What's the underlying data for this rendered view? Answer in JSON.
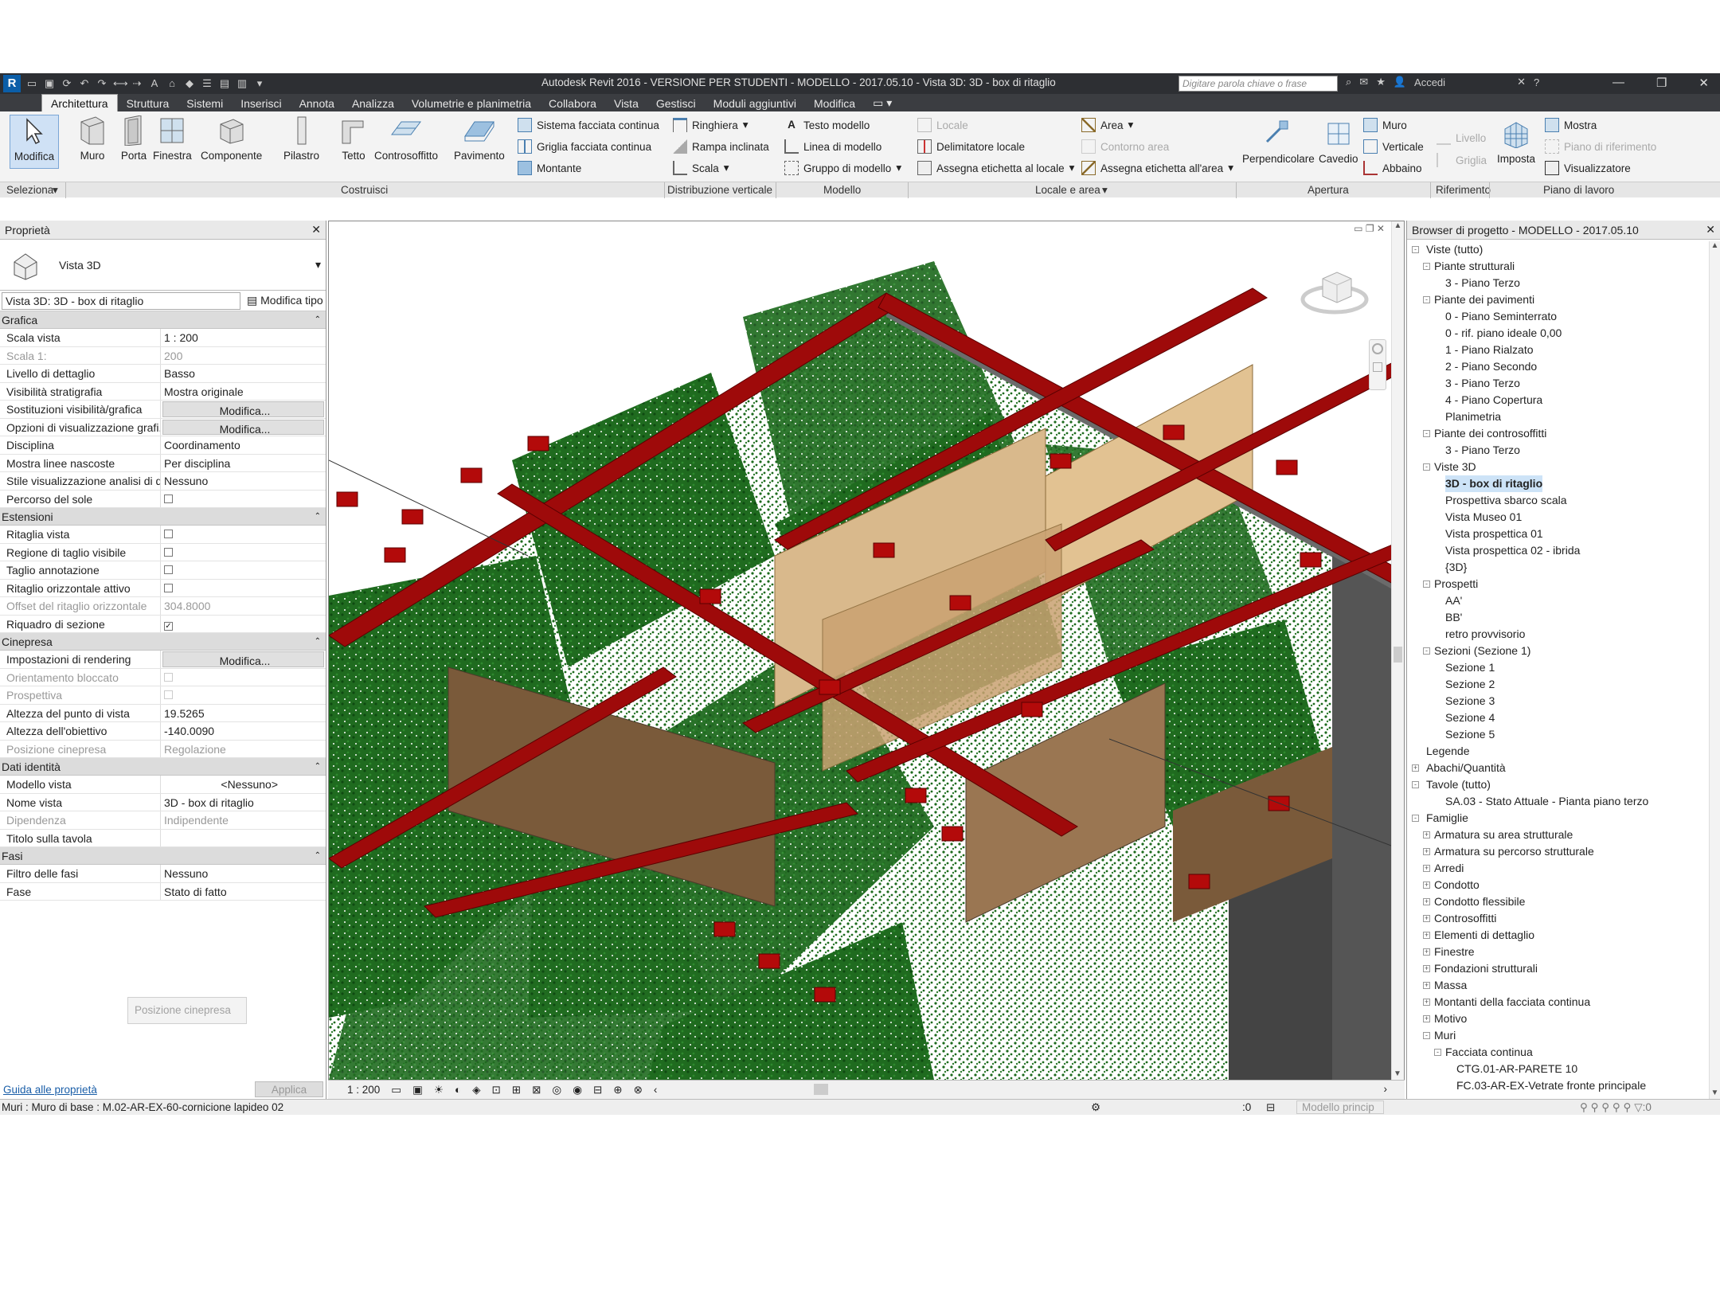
{
  "window": {
    "title": "Autodesk Revit 2016 - VERSIONE PER STUDENTI -    MODELLO - 2017.05.10 - Vista 3D: 3D - box di ritaglio",
    "search_placeholder": "Digitare parola chiave o frase",
    "signin": "Accedi"
  },
  "tabs": [
    "Architettura",
    "Struttura",
    "Sistemi",
    "Inserisci",
    "Annota",
    "Analizza",
    "Volumetrie e planimetria",
    "Collabora",
    "Vista",
    "Gestisci",
    "Moduli aggiuntivi",
    "Modifica"
  ],
  "ribbon": {
    "big": [
      "Modifica",
      "Muro",
      "Porta",
      "Finestra",
      "Componente",
      "Pilastro",
      "Tetto",
      "Controsoffitto",
      "Pavimento",
      "Perpendicolare",
      "Cavedio",
      "Livello",
      "Griglia",
      "Imposta"
    ],
    "small": [
      "Sistema facciata continua",
      "Griglia facciata continua",
      "Montante",
      "Ringhiera",
      "Rampa inclinata",
      "Scala",
      "Testo modello",
      "Linea di modello",
      "Gruppo di modello",
      "Locale",
      "Delimitatore  locale",
      "Assegna etichetta  al locale",
      "Area",
      "Contorno  area",
      "Assegna etichetta  all'area",
      "Muro",
      "Verticale",
      "Abbaino",
      "Mostra",
      "Piano di riferimento",
      "Visualizzatore"
    ],
    "panels": [
      "Seleziona",
      "Costruisci",
      "Distribuzione verticale",
      "Modello",
      "Locale e area",
      "Apertura",
      "Riferimento",
      "Piano di lavoro"
    ]
  },
  "properties": {
    "title": "Proprietà",
    "type": "Vista 3D",
    "instance": "Vista 3D: 3D - box di ritaglio",
    "edit_type": "Modifica tipo",
    "sections": [
      {
        "name": "Grafica",
        "rows": [
          [
            "Scala vista",
            "1 : 200",
            ""
          ],
          [
            "Scala  1:",
            "200",
            "gray"
          ],
          [
            "Livello di dettaglio",
            "Basso",
            ""
          ],
          [
            "Visibilità stratigrafia",
            "Mostra originale",
            ""
          ],
          [
            "Sostituzioni visibilità/grafica",
            "Modifica...",
            "btn"
          ],
          [
            "Opzioni di visualizzazione grafi...",
            "Modifica...",
            "btn"
          ],
          [
            "Disciplina",
            "Coordinamento",
            ""
          ],
          [
            "Mostra linee nascoste",
            "Per disciplina",
            ""
          ],
          [
            "Stile visualizzazione analisi di d...",
            "Nessuno",
            ""
          ],
          [
            "Percorso del sole",
            "",
            "cb0"
          ]
        ]
      },
      {
        "name": "Estensioni",
        "rows": [
          [
            "Ritaglia vista",
            "",
            "cb0"
          ],
          [
            "Regione di taglio visibile",
            "",
            "cb0"
          ],
          [
            "Taglio annotazione",
            "",
            "cb0"
          ],
          [
            "Ritaglio orizzontale attivo",
            "",
            "cb0"
          ],
          [
            "Offset del ritaglio orizzontale",
            "304.8000",
            "gray"
          ],
          [
            "Riquadro di sezione",
            "",
            "cb1"
          ]
        ]
      },
      {
        "name": "Cinepresa",
        "rows": [
          [
            "Impostazioni di rendering",
            "Modifica...",
            "btn"
          ],
          [
            "Orientamento bloccato",
            "",
            "graycb"
          ],
          [
            "Prospettiva",
            "",
            "graycb"
          ],
          [
            "Altezza del punto di vista",
            "19.5265",
            ""
          ],
          [
            "Altezza dell'obiettivo",
            "-140.0090",
            ""
          ],
          [
            "Posizione cinepresa",
            "Regolazione",
            "gray"
          ]
        ]
      },
      {
        "name": "Dati identità",
        "rows": [
          [
            "Modello vista",
            "<Nessuno>",
            "right"
          ],
          [
            "Nome vista",
            "3D - box di ritaglio",
            ""
          ],
          [
            "Dipendenza",
            "Indipendente",
            "gray"
          ],
          [
            "Titolo sulla tavola",
            "",
            ""
          ]
        ]
      },
      {
        "name": "Fasi",
        "rows": [
          [
            "Filtro delle fasi",
            "Nessuno",
            ""
          ],
          [
            "Fase",
            "Stato di fatto",
            ""
          ]
        ]
      }
    ],
    "tooltip": "Posizione cinepresa",
    "help_link": "Guida alle proprietà",
    "apply": "Applica"
  },
  "view": {
    "scale": "1 : 200"
  },
  "browser": {
    "title": "Browser di progetto - MODELLO - 2017.05.10",
    "tree": [
      [
        0,
        "Viste (tutto)",
        "-"
      ],
      [
        1,
        "Piante strutturali",
        "-"
      ],
      [
        2,
        "3 - Piano Terzo",
        ""
      ],
      [
        1,
        "Piante dei pavimenti",
        "-"
      ],
      [
        2,
        "0 - Piano Seminterrato",
        ""
      ],
      [
        2,
        "0 - rif. piano ideale 0,00",
        ""
      ],
      [
        2,
        "1 - Piano Rialzato",
        ""
      ],
      [
        2,
        "2 - Piano Secondo",
        ""
      ],
      [
        2,
        "3 - Piano Terzo",
        ""
      ],
      [
        2,
        "4 - Piano Copertura",
        ""
      ],
      [
        2,
        "Planimetria",
        ""
      ],
      [
        1,
        "Piante dei controsoffitti",
        "-"
      ],
      [
        2,
        "3 - Piano Terzo",
        ""
      ],
      [
        1,
        "Viste 3D",
        "-"
      ],
      [
        2,
        "3D - box di ritaglio",
        "b"
      ],
      [
        2,
        "Prospettiva sbarco scala",
        ""
      ],
      [
        2,
        "Vista Museo 01",
        ""
      ],
      [
        2,
        "Vista prospettica 01",
        ""
      ],
      [
        2,
        "Vista prospettica 02 - ibrida",
        ""
      ],
      [
        2,
        "{3D}",
        ""
      ],
      [
        1,
        "Prospetti",
        "-"
      ],
      [
        2,
        "AA'",
        ""
      ],
      [
        2,
        "BB'",
        ""
      ],
      [
        2,
        "retro provvisorio",
        ""
      ],
      [
        1,
        "Sezioni (Sezione 1)",
        "-"
      ],
      [
        2,
        "Sezione 1",
        ""
      ],
      [
        2,
        "Sezione 2",
        ""
      ],
      [
        2,
        "Sezione 3",
        ""
      ],
      [
        2,
        "Sezione 4",
        ""
      ],
      [
        2,
        "Sezione 5",
        ""
      ],
      [
        0,
        "Legende",
        ""
      ],
      [
        0,
        "Abachi/Quantità",
        "+"
      ],
      [
        0,
        "Tavole (tutto)",
        "-"
      ],
      [
        2,
        "SA.03 - Stato Attuale - Pianta piano terzo",
        ""
      ],
      [
        0,
        "Famiglie",
        "-"
      ],
      [
        1,
        "Armatura su area strutturale",
        "+"
      ],
      [
        1,
        "Armatura su percorso strutturale",
        "+"
      ],
      [
        1,
        "Arredi",
        "+"
      ],
      [
        1,
        "Condotto",
        "+"
      ],
      [
        1,
        "Condotto flessibile",
        "+"
      ],
      [
        1,
        "Controsoffitti",
        "+"
      ],
      [
        1,
        "Elementi di dettaglio",
        "+"
      ],
      [
        1,
        "Finestre",
        "+"
      ],
      [
        1,
        "Fondazioni strutturali",
        "+"
      ],
      [
        1,
        "Massa",
        "+"
      ],
      [
        1,
        "Montanti della facciata continua",
        "+"
      ],
      [
        1,
        "Motivo",
        "+"
      ],
      [
        1,
        "Muri",
        "-"
      ],
      [
        2,
        "Facciata continua",
        "-"
      ],
      [
        3,
        "CTG.01-AR-PARETE 10",
        ""
      ],
      [
        3,
        "FC.03-AR-EX-Vetrate fronte principale",
        ""
      ]
    ]
  },
  "status": {
    "text": "Muri : Muro di base : M.02-AR-EX-60-cornicione lapideo 02",
    "model": "Modello princip",
    "zero": ":0"
  }
}
